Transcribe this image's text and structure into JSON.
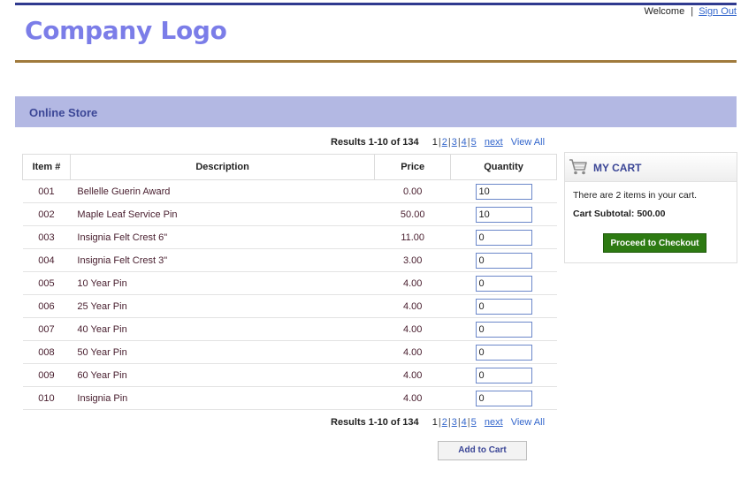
{
  "header": {
    "welcome_text": "Welcome",
    "separator": "|",
    "sign_out": "Sign Out",
    "logo_text": "Company Logo"
  },
  "store": {
    "title": "Online Store"
  },
  "pager": {
    "results": "Results 1-10 of 134",
    "pages": [
      "1",
      "2",
      "3",
      "4",
      "5"
    ],
    "next": "next",
    "view_all": "View All"
  },
  "table": {
    "headers": [
      "Item #",
      "Description",
      "Price",
      "Quantity"
    ],
    "rows": [
      {
        "item": "001",
        "description": "Bellelle Guerin Award",
        "price": "0.00",
        "quantity": "10"
      },
      {
        "item": "002",
        "description": "Maple Leaf Service Pin",
        "price": "50.00",
        "quantity": "10"
      },
      {
        "item": "003",
        "description": "Insignia Felt Crest 6\"",
        "price": "11.00",
        "quantity": "0"
      },
      {
        "item": "004",
        "description": "Insignia Felt Crest 3\"",
        "price": "3.00",
        "quantity": "0"
      },
      {
        "item": "005",
        "description": "10 Year Pin",
        "price": "4.00",
        "quantity": "0"
      },
      {
        "item": "006",
        "description": "25 Year Pin",
        "price": "4.00",
        "quantity": "0"
      },
      {
        "item": "007",
        "description": "40 Year Pin",
        "price": "4.00",
        "quantity": "0"
      },
      {
        "item": "008",
        "description": "50 Year Pin",
        "price": "4.00",
        "quantity": "0"
      },
      {
        "item": "009",
        "description": "60 Year Pin",
        "price": "4.00",
        "quantity": "0"
      },
      {
        "item": "010",
        "description": "Insignia Pin",
        "price": "4.00",
        "quantity": "0"
      }
    ]
  },
  "cart": {
    "icon": "shopping-cart-icon",
    "title": "MY CART",
    "message": "There are 2 items in your cart.",
    "subtotal": "Cart Subtotal: 500.00",
    "checkout_label": "Proceed to Checkout"
  },
  "actions": {
    "add_to_cart": "Add to Cart"
  },
  "colors": {
    "logo": "#7b7de8",
    "top_rule": "#2f3a8f",
    "brown_rule": "#a07a3c",
    "store_header_bg": "#b3b8e3",
    "store_title": "#3b4696",
    "checkout_bg": "#2d7a12",
    "link": "#3366cc"
  }
}
